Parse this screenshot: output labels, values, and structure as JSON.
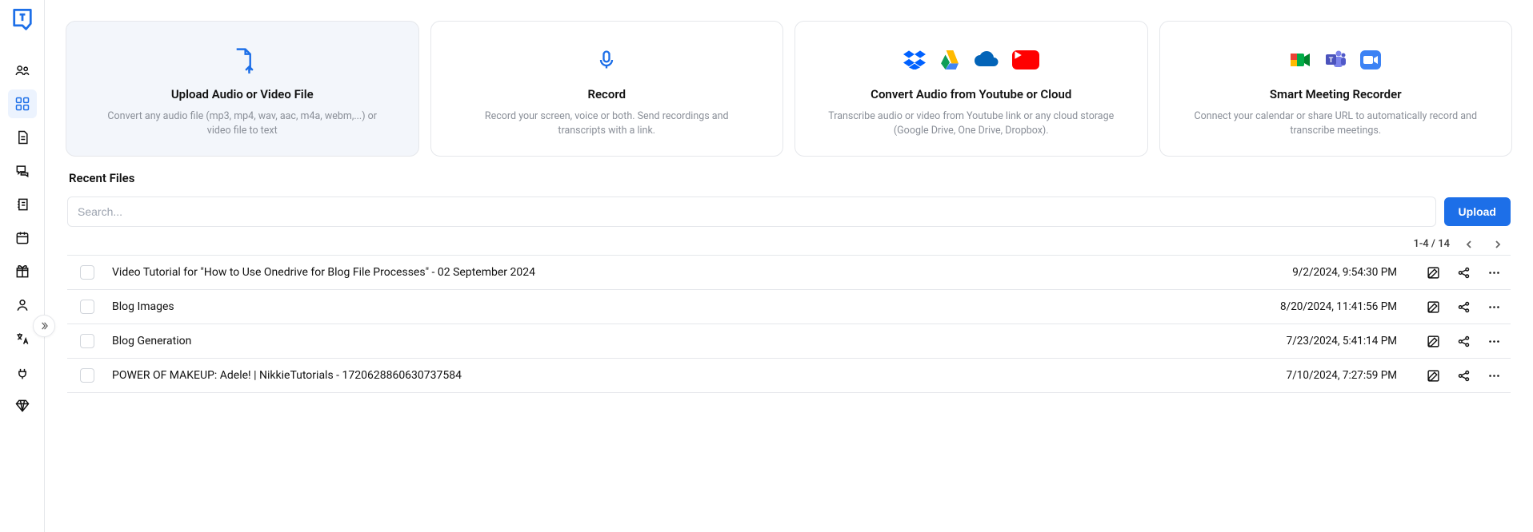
{
  "sidebar": {
    "items": [
      {
        "name": "team-icon"
      },
      {
        "name": "dashboard-icon"
      },
      {
        "name": "document-icon"
      },
      {
        "name": "chat-icon"
      },
      {
        "name": "notes-icon"
      },
      {
        "name": "calendar-icon"
      },
      {
        "name": "gift-icon"
      },
      {
        "name": "profile-icon"
      },
      {
        "name": "translate-icon"
      },
      {
        "name": "plug-icon"
      },
      {
        "name": "diamond-icon"
      }
    ],
    "active_index": 1
  },
  "cards": [
    {
      "title": "Upload Audio or Video File",
      "desc": "Convert any audio file (mp3, mp4, wav, aac, m4a, webm,...) or video file to text"
    },
    {
      "title": "Record",
      "desc": "Record your screen, voice or both. Send recordings and transcripts with a link."
    },
    {
      "title": "Convert Audio from Youtube or Cloud",
      "desc": "Transcribe audio or video from Youtube link or any cloud storage (Google Drive, One Drive, Dropbox)."
    },
    {
      "title": "Smart Meeting Recorder",
      "desc": "Connect your calendar or share URL to automatically record and transcribe meetings."
    }
  ],
  "recent": {
    "title": "Recent Files",
    "search_placeholder": "Search...",
    "upload_label": "Upload",
    "pager": "1-4 / 14",
    "rows": [
      {
        "name": "Video Tutorial for \"How to Use Onedrive for Blog File Processes\" - 02 September 2024",
        "date": "9/2/2024, 9:54:30 PM"
      },
      {
        "name": "Blog Images",
        "date": "8/20/2024, 11:41:56 PM"
      },
      {
        "name": "Blog Generation",
        "date": "7/23/2024, 5:41:14 PM"
      },
      {
        "name": "POWER OF MAKEUP: Adele! | NikkieTutorials - 1720628860630737584",
        "date": "7/10/2024, 7:27:59 PM"
      }
    ]
  }
}
